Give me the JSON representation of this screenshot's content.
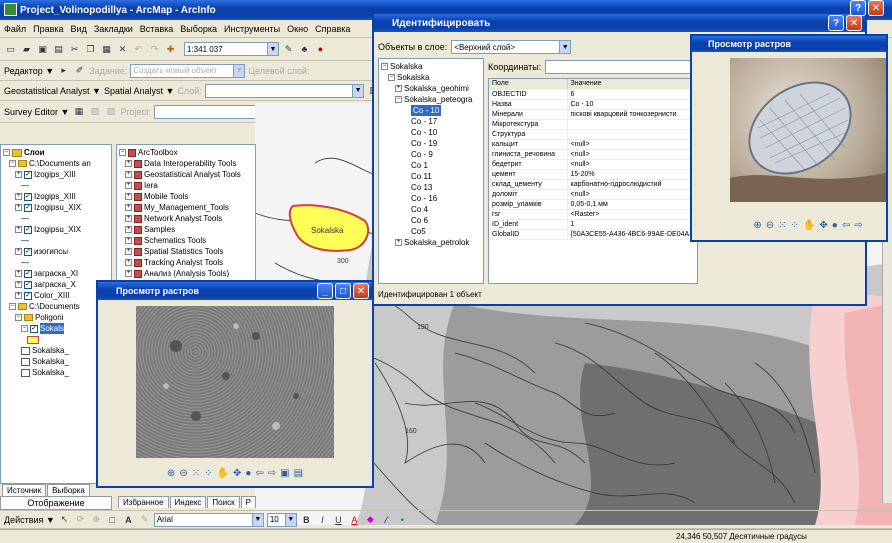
{
  "app": {
    "title": "Project_Volinopodillya - ArcMap - ArcInfo"
  },
  "menu": [
    "Файл",
    "Правка",
    "Вид",
    "Закладки",
    "Вставка",
    "Выборка",
    "Инструменты",
    "Окно",
    "Справка"
  ],
  "toolbar": {
    "scale": "1:341 037",
    "editor_label": "Редактор ▼",
    "task_label": "Задание:",
    "task_value": "Создать новый объект",
    "target_label": "Целевой слой:",
    "geostat_label": "Geostatistical Analyst ▼",
    "spatial_label": "Spatial Analyst ▼",
    "layer_label": "Слой:",
    "survey_label": "Survey Editor ▼",
    "project_label": "Project:"
  },
  "toc": {
    "root": "Слои",
    "items": [
      {
        "t": "C:\\Documents an",
        "pm": "−",
        "chk": false,
        "lvl": 1,
        "type": "folder"
      },
      {
        "t": "Izogips_XIII",
        "pm": "+",
        "chk": true,
        "lvl": 2
      },
      {
        "t": "—",
        "pm": "",
        "chk": false,
        "lvl": 3,
        "type": "line"
      },
      {
        "t": "Izogips_XIII",
        "pm": "+",
        "chk": true,
        "lvl": 2
      },
      {
        "t": "Izogipsu_XIX",
        "pm": "+",
        "chk": true,
        "lvl": 2
      },
      {
        "t": "—",
        "pm": "",
        "chk": false,
        "lvl": 3,
        "type": "line"
      },
      {
        "t": "Izogipsu_XIX",
        "pm": "+",
        "chk": true,
        "lvl": 2
      },
      {
        "t": "—",
        "pm": "",
        "chk": false,
        "lvl": 3,
        "type": "line"
      },
      {
        "t": "изогипсы",
        "pm": "+",
        "chk": true,
        "lvl": 2
      },
      {
        "t": "—",
        "pm": "",
        "chk": false,
        "lvl": 3,
        "type": "line"
      },
      {
        "t": "заграска_XI",
        "pm": "+",
        "chk": true,
        "lvl": 2
      },
      {
        "t": "заграска_X",
        "pm": "+",
        "chk": true,
        "lvl": 2
      },
      {
        "t": "Color_XIII",
        "pm": "+",
        "chk": true,
        "lvl": 2
      },
      {
        "t": "C:\\Documents",
        "pm": "−",
        "chk": false,
        "lvl": 1,
        "type": "folder"
      },
      {
        "t": "Poligoni",
        "pm": "−",
        "chk": false,
        "lvl": 2,
        "type": "folder"
      },
      {
        "t": "Sokals",
        "pm": "−",
        "chk": true,
        "lvl": 3,
        "sel": true
      },
      {
        "t": "",
        "pm": "",
        "chk": false,
        "lvl": 4,
        "type": "swatch"
      },
      {
        "t": "Sokalska_",
        "pm": "",
        "chk": false,
        "lvl": 3,
        "type": "table"
      },
      {
        "t": "Sokalska_",
        "pm": "",
        "chk": false,
        "lvl": 3,
        "type": "table"
      },
      {
        "t": "Sokalska_",
        "pm": "",
        "chk": false,
        "lvl": 3,
        "type": "table"
      }
    ],
    "tabs": [
      "Источник",
      "Выборка"
    ],
    "bottom_tab": "Отображение"
  },
  "arctoolbox": {
    "title": "ArcToolbox",
    "items": [
      "Data Interoperability Tools",
      "Geostatistical Analyst Tools",
      "Iera",
      "Mobile Tools",
      "My_Management_Tools",
      "Network Analyst Tools",
      "Samples",
      "Schematics Tools",
      "Spatial Statistics Tools",
      "Tracking Analyst Tools",
      "Анализ (Analysis Tools)"
    ],
    "tabs": [
      "Избранное",
      "Индекс",
      "Поиск",
      "Р"
    ]
  },
  "map": {
    "polygon_label": "Sokalska",
    "contour_labels": [
      "300",
      "190",
      "160"
    ]
  },
  "identify": {
    "title": "Идентифицировать",
    "layers_label": "Объекты в слое:",
    "layers_value": "<Верхний слой>",
    "coords_label": "Координаты:",
    "tree": [
      {
        "t": "Sokalska",
        "lvl": 0,
        "pm": "−"
      },
      {
        "t": "Sokalska",
        "lvl": 1,
        "pm": "−"
      },
      {
        "t": "Sokalska_geohimi",
        "lvl": 2,
        "pm": "+"
      },
      {
        "t": "Sokalska_peteogra",
        "lvl": 2,
        "pm": "−"
      },
      {
        "t": "Co - 10",
        "lvl": 3,
        "sel": true
      },
      {
        "t": "Co - 17",
        "lvl": 3
      },
      {
        "t": "Co - 10",
        "lvl": 3
      },
      {
        "t": "Co - 19",
        "lvl": 3
      },
      {
        "t": "Co - 9",
        "lvl": 3
      },
      {
        "t": "Co 1",
        "lvl": 3
      },
      {
        "t": "Co 11",
        "lvl": 3
      },
      {
        "t": "Co 13",
        "lvl": 3
      },
      {
        "t": "Co - 16",
        "lvl": 3
      },
      {
        "t": "Co 4",
        "lvl": 3
      },
      {
        "t": "Co 6",
        "lvl": 3
      },
      {
        "t": "Co5",
        "lvl": 3
      },
      {
        "t": "Sokalska_petrolok",
        "lvl": 2,
        "pm": "+"
      }
    ],
    "grid_header": [
      "Поле",
      "Значение"
    ],
    "grid": [
      [
        "OBJECTID",
        "6"
      ],
      [
        "Назва",
        "Co - 10"
      ],
      [
        "Мінерали",
        "піскові кварцовий тонкозернисти"
      ],
      [
        "Мікротекстура",
        ""
      ],
      [
        "Структура",
        ""
      ],
      [
        "кальцит",
        "<null>"
      ],
      [
        "глиниста_речовина",
        "<null>"
      ],
      [
        "бедетрит",
        "<null>"
      ],
      [
        "цемент",
        "15-20%"
      ],
      [
        "склад_цементу",
        "карбонатно-гідрослюдистий"
      ],
      [
        "доломіт",
        "<null>"
      ],
      [
        "розмір_уламків",
        "0,05-0,1 мм"
      ],
      [
        "гѕг",
        "<Raster>"
      ],
      [
        "ID_ident",
        "1"
      ],
      [
        "GlobalID",
        "{50A3CE55-A436-4BC6-99AE-DE04A"
      ]
    ],
    "status": "Идентифицирован 1 объект"
  },
  "raster_small": {
    "title": "Просмотр растров"
  },
  "raster_large": {
    "title": "Просмотр растров"
  },
  "draw": {
    "label": "Действия ▼",
    "font": "Arial",
    "size": "10"
  },
  "statusbar": {
    "coords": "24,346  50,507 Десятичные градусы"
  }
}
